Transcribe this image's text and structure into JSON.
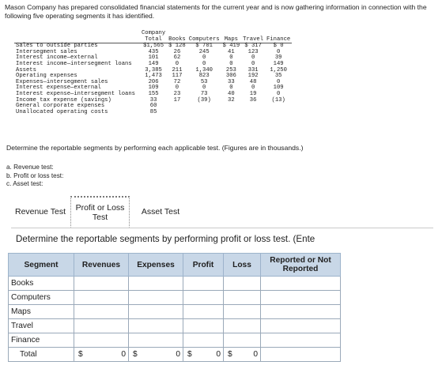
{
  "intro": "Mason Company has prepared consolidated financial statements for the current year and is now gathering information in connection with the following five operating segments it has identified.",
  "data_table": {
    "headers": [
      "",
      "Company\nTotal",
      "Books",
      "Computers",
      "Maps",
      "Travel",
      "Finance"
    ],
    "rows": [
      {
        "label": "Sales to outside parties",
        "values": [
          "$1,565",
          "$ 128",
          "$  701",
          "$ 419",
          "$ 317",
          "$    0"
        ]
      },
      {
        "label": "Intersegment sales",
        "values": [
          "435",
          "26",
          "245",
          "41",
          "123",
          "0"
        ]
      },
      {
        "label": "Interest income—external",
        "values": [
          "101",
          "62",
          "0",
          "0",
          "0",
          "39"
        ]
      },
      {
        "label": "Interest income—intersegment loans",
        "values": [
          "149",
          "0",
          "0",
          "0",
          "0",
          "149"
        ]
      },
      {
        "label": "Assets",
        "values": [
          "3,385",
          "211",
          "1,340",
          "253",
          "331",
          "1,250"
        ]
      },
      {
        "label": "Operating expenses",
        "values": [
          "1,473",
          "117",
          "823",
          "306",
          "192",
          "35"
        ]
      },
      {
        "label": "Expenses—intersegment sales",
        "values": [
          "206",
          "72",
          "53",
          "33",
          "48",
          "0"
        ]
      },
      {
        "label": "Interest expense—external",
        "values": [
          "109",
          "0",
          "0",
          "0",
          "0",
          "109"
        ]
      },
      {
        "label": "Interest expense—intersegment loans",
        "values": [
          "155",
          "23",
          "73",
          "40",
          "19",
          "0"
        ]
      },
      {
        "label": "Income tax expense (savings)",
        "values": [
          "33",
          "17",
          "(39)",
          "32",
          "36",
          "(13)"
        ]
      },
      {
        "label": "General corporate expenses",
        "values": [
          "60",
          "",
          "",
          "",
          "",
          ""
        ]
      },
      {
        "label": "Unallocated operating costs",
        "values": [
          "85",
          "",
          "",
          "",
          "",
          ""
        ]
      }
    ]
  },
  "instruction": "Determine the reportable segments by performing each applicable test. (Figures are in thousands.)",
  "tests": {
    "a": "a. Revenue test:",
    "b": "b. Profit or loss test:",
    "c": "c. Asset test:"
  },
  "tabs": {
    "revenue": "Revenue Test",
    "profit": "Profit or Loss\nTest",
    "asset": "Asset Test"
  },
  "prompt": "Determine the reportable segments by performing profit or loss test. (Ente",
  "grid": {
    "headers": {
      "segment": "Segment",
      "revenues": "Revenues",
      "expenses": "Expenses",
      "profit": "Profit",
      "loss": "Loss",
      "reported": "Reported or Not Reported"
    },
    "segments": [
      "Books",
      "Computers",
      "Maps",
      "Travel",
      "Finance"
    ],
    "total_label": "Total",
    "currency": "$",
    "totals": {
      "revenues": "0",
      "expenses": "0",
      "profit": "0",
      "loss": "0"
    }
  }
}
